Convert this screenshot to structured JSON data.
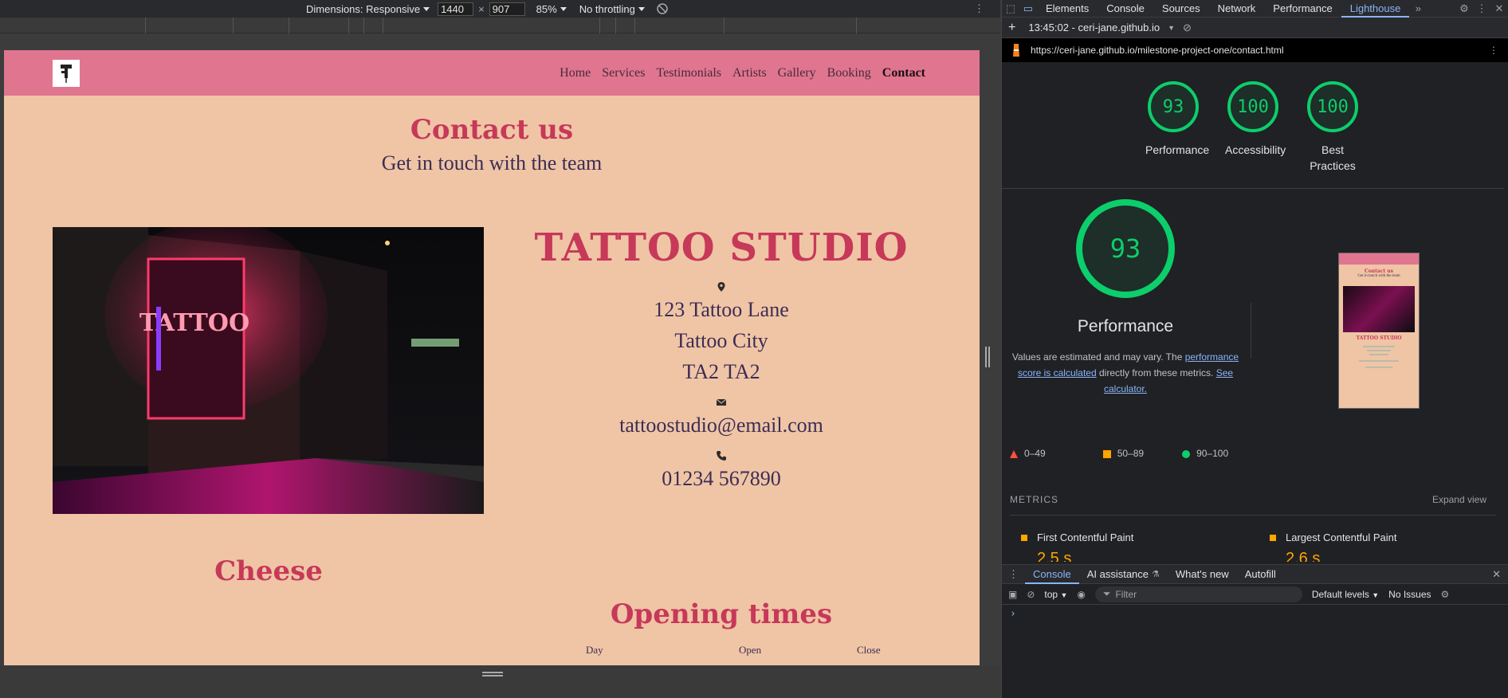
{
  "emulation": {
    "dimensions_label": "Dimensions: Responsive",
    "width": "1440",
    "height": "907",
    "times": "×",
    "zoom": "85%",
    "throttle": "No throttling"
  },
  "site": {
    "nav": [
      "Home",
      "Services",
      "Testimonials",
      "Artists",
      "Gallery",
      "Booking",
      "Contact"
    ],
    "active_nav": "Contact",
    "title": "Contact us",
    "subtitle": "Get in touch with the team",
    "studio_name": "TATTOO STUDIO",
    "address": [
      "123 Tattoo Lane",
      "Tattoo City",
      "TA2 TA2"
    ],
    "email": "tattoostudio@email.com",
    "phone": "01234 567890",
    "section_cheese": "Cheese",
    "opening_title": "Opening times",
    "hours_headers": [
      "Day",
      "Open",
      "Close"
    ]
  },
  "devtools": {
    "tabs": [
      "Elements",
      "Console",
      "Sources",
      "Network",
      "Performance",
      "Lighthouse"
    ],
    "active_tab": "Lighthouse",
    "report_label": "13:45:02 - ceri-jane.github.io",
    "url": "https://ceri-jane.github.io/milestone-project-one/contact.html",
    "scores": [
      {
        "label": "Performance",
        "value": "93"
      },
      {
        "label": "Accessibility",
        "value": "100"
      },
      {
        "label": "Best Practices",
        "value": "100"
      }
    ],
    "main_score": "93",
    "main_title": "Performance",
    "note_pre": "Values are estimated and may vary. The ",
    "note_link1": "performance score is calculated",
    "note_mid": " directly from these metrics. ",
    "note_link2": "See calculator.",
    "legend": [
      "0–49",
      "50–89",
      "90–100"
    ],
    "metrics_label": "METRICS",
    "expand_label": "Expand view",
    "metric1_label": "First Contentful Paint",
    "metric1_value": "2.5 s",
    "metric2_label": "Largest Contentful Paint",
    "metric2_value": "2.6 s",
    "colors": {
      "good": "#0cce6b",
      "average": "#ffa400",
      "poor": "#ff4e42"
    }
  },
  "drawer": {
    "tabs": [
      "Console",
      "AI assistance",
      "What's new",
      "Autofill"
    ],
    "active_tab": "Console",
    "context": "top",
    "filter_placeholder": "Filter",
    "levels": "Default levels",
    "issues": "No Issues",
    "prompt": "›"
  },
  "thumbnail": {
    "title": "Contact us",
    "subtitle": "Get in touch with the team",
    "studio": "TATTOO STUDIO"
  }
}
